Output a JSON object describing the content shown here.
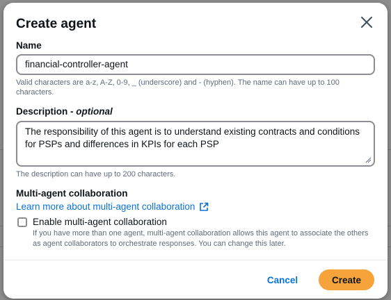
{
  "dialog": {
    "title": "Create agent",
    "close_icon": "close-icon"
  },
  "name_field": {
    "label": "Name",
    "value": "financial-controller-agent",
    "hint": "Valid characters are a-z, A-Z, 0-9, _ (underscore) and - (hyphen). The name can have up to 100 characters."
  },
  "description_field": {
    "label": "Description",
    "label_suffix": "optional",
    "separator": " - ",
    "value": "The responsibility of this agent is to understand existing contracts and conditions for PSPs and differences in KPIs for each PSP",
    "hint": "The description can have up to 200 characters."
  },
  "collaboration": {
    "heading": "Multi-agent collaboration",
    "link_label": "Learn more about multi-agent collaboration",
    "link_icon": "external-link-icon",
    "checkbox_label": "Enable multi-agent collaboration",
    "checkbox_checked": false,
    "checkbox_description": "If you have more than one agent, multi-agent collaboration allows this agent to associate the others as agent collaborators to orchestrate responses. You can change this later."
  },
  "footer": {
    "cancel_label": "Cancel",
    "create_label": "Create"
  },
  "colors": {
    "primary_button": "#f5a33a",
    "link": "#0972d3",
    "text": "#0f141a",
    "hint_text": "#5f6b7a",
    "overlay": "#8e8e8e"
  }
}
